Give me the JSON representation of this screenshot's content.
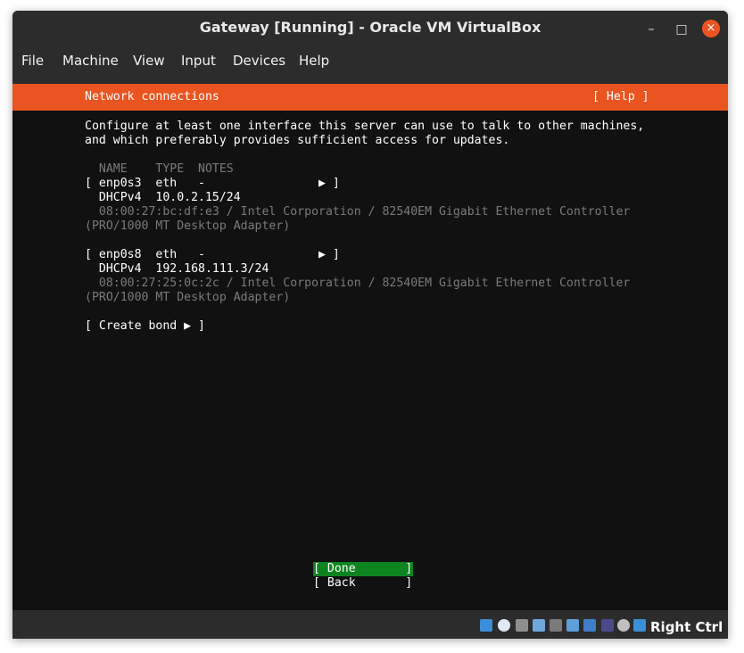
{
  "window": {
    "title": "Gateway [Running] - Oracle VM VirtualBox",
    "minimize": "–",
    "maximize": "□",
    "close": "×"
  },
  "menu": [
    "File",
    "Machine",
    "View",
    "Input",
    "Devices",
    "Help"
  ],
  "installer": {
    "header_title": "Network connections",
    "help_button": "[ Help ]",
    "intro_line1": "Configure at least one interface this server can use to talk to other machines,",
    "intro_line2": "and which preferably provides sufficient access for updates.",
    "columns_header": "  NAME    TYPE  NOTES",
    "interfaces": [
      {
        "row": "[ enp0s3  eth   -                ▶ ]",
        "address": "  DHCPv4  10.0.2.15/24",
        "hw_line1": "  08:00:27:bc:df:e3 / Intel Corporation / 82540EM Gigabit Ethernet Controller",
        "hw_line2": "(PRO/1000 MT Desktop Adapter)"
      },
      {
        "row": "[ enp0s8  eth   -                ▶ ]",
        "address": "  DHCPv4  192.168.111.3/24",
        "hw_line1": "  08:00:27:25:0c:2c / Intel Corporation / 82540EM Gigabit Ethernet Controller",
        "hw_line2": "(PRO/1000 MT Desktop Adapter)"
      }
    ],
    "create_bond": "[ Create bond ▶ ]",
    "done_button": "[ Done       ]",
    "back_button": "[ Back       ]"
  },
  "statusbar": {
    "icons": [
      "hard-disk-icon",
      "optical-drive-icon",
      "audio-icon",
      "network-icon",
      "usb-icon",
      "shared-folders-icon",
      "display-icon",
      "video-capture-icon",
      "virtualization-icon",
      "mouse-integration-icon",
      "keyboard-capture-icon"
    ],
    "host_key": "Right Ctrl"
  }
}
